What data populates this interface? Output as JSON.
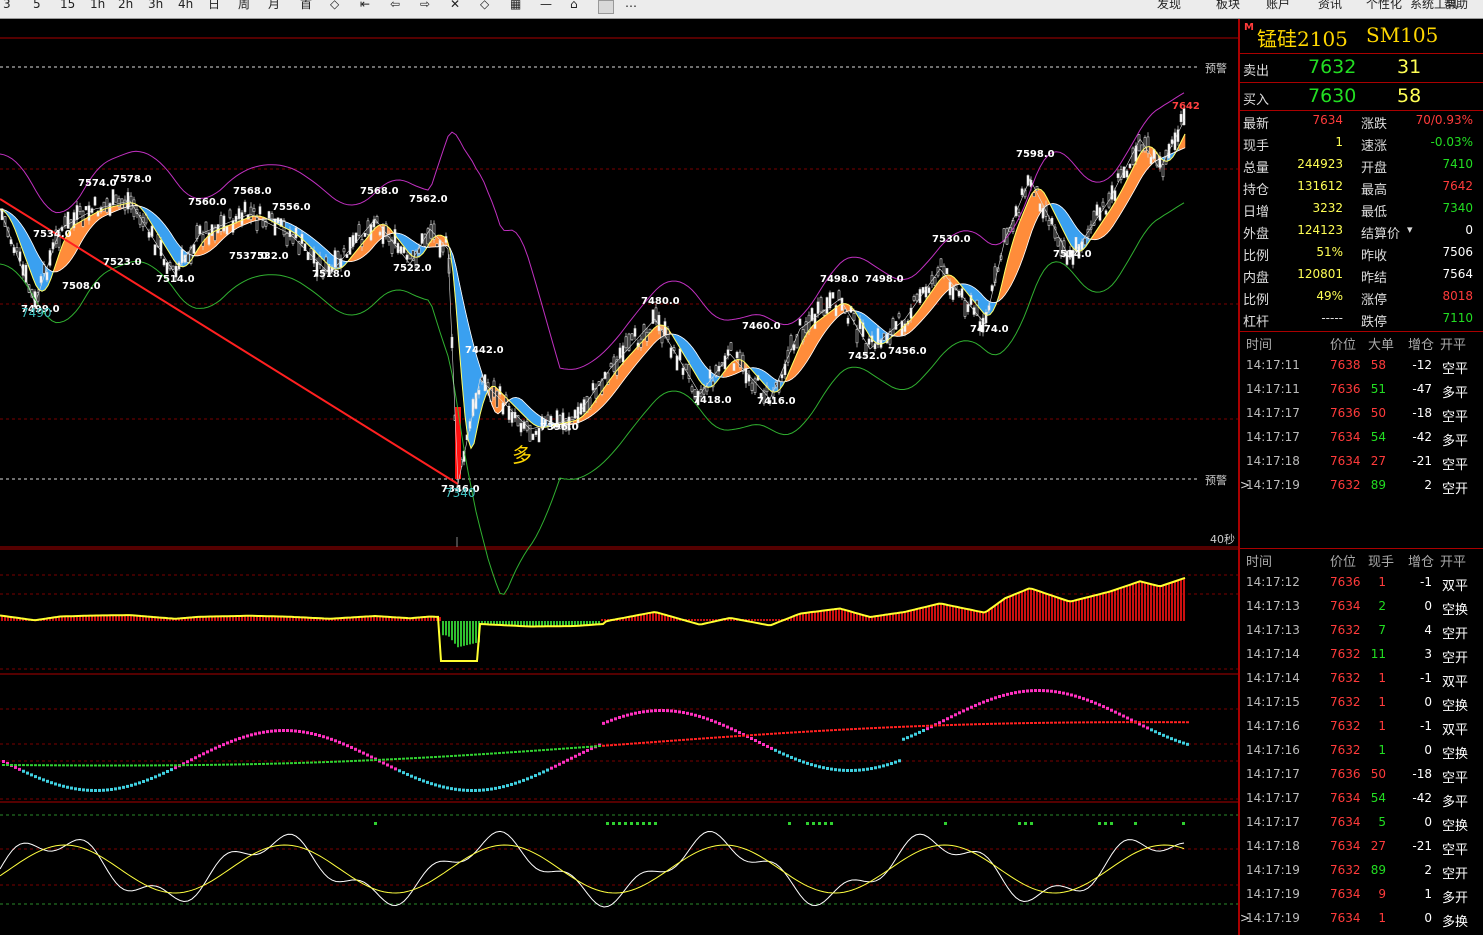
{
  "toolbar": {
    "left_items": [
      "3",
      "5",
      "15",
      "1h",
      "2h",
      "3h",
      "4h",
      "日",
      "周",
      "月",
      "首",
      "◇",
      "⇤",
      "⇦",
      "⇨",
      "✕",
      "◇",
      "▦",
      "—",
      "⌂"
    ],
    "menus": [
      "发现",
      "板块",
      "账户",
      "资讯",
      "个性化",
      "系统工具",
      "帮助"
    ]
  },
  "chart": {
    "price_labels": [
      "7574.0",
      "7578.0",
      "7560.0",
      "7568.0",
      "7556.0",
      "7568.0",
      "7562.0",
      "7534.0",
      "7523.0",
      "7537.0",
      "7532.0",
      "7514.0",
      "7508.0",
      "7499.0",
      "7490",
      "7518.0",
      "7522.0",
      "7442.0",
      "7396.0",
      "7346.0",
      "7340",
      "7480.0",
      "7460.0",
      "7498.0",
      "7498.0",
      "7418.0",
      "7416.0",
      "7452.0",
      "7456.0",
      "7530.0",
      "7474.0",
      "7598.0",
      "7534.0",
      "7642"
    ],
    "alert_label": "预警",
    "interval_label": "40秒",
    "signal_label": "多"
  },
  "quote": {
    "title": "锰硅2105",
    "code": "SM105",
    "marker": "M",
    "sell_label": "卖出",
    "sell_price": "7632",
    "sell_vol": "31",
    "buy_label": "买入",
    "buy_price": "7630",
    "buy_vol": "58",
    "rows": [
      {
        "l1": "最新",
        "v1": "7634",
        "c1": "#ff3b3b",
        "l2": "涨跌",
        "v2": "70/0.93%",
        "c2": "#ff3b3b"
      },
      {
        "l1": "现手",
        "v1": "1",
        "c1": "#ffff55",
        "l2": "速涨",
        "v2": "-0.03%",
        "c2": "#22dd22"
      },
      {
        "l1": "总量",
        "v1": "244923",
        "c1": "#ffff55",
        "l2": "开盘",
        "v2": "7410",
        "c2": "#22dd22"
      },
      {
        "l1": "持仓",
        "v1": "131612",
        "c1": "#ffff55",
        "l2": "最高",
        "v2": "7642",
        "c2": "#ff3b3b"
      },
      {
        "l1": "日增",
        "v1": "3232",
        "c1": "#ffff55",
        "l2": "最低",
        "v2": "7340",
        "c2": "#22dd22"
      },
      {
        "l1": "外盘",
        "v1": "124123",
        "c1": "#ffff55",
        "l2": "结算价",
        "v2": "0",
        "c2": "#ffffff"
      },
      {
        "l1": "比例",
        "v1": "51%",
        "c1": "#ffff55",
        "l2": "昨收",
        "v2": "7506",
        "c2": "#ffffff"
      },
      {
        "l1": "内盘",
        "v1": "120801",
        "c1": "#ffff55",
        "l2": "昨结",
        "v2": "7564",
        "c2": "#ffffff"
      },
      {
        "l1": "比例",
        "v1": "49%",
        "c1": "#ffff55",
        "l2": "涨停",
        "v2": "8018",
        "c2": "#ff3b3b"
      },
      {
        "l1": "杠杆",
        "v1": "-----",
        "c1": "#dddddd",
        "l2": "跌停",
        "v2": "7110",
        "c2": "#22dd22"
      }
    ],
    "trades1_header": {
      "time": "时间",
      "price": "价位",
      "big": "大单",
      "chg": "增仓",
      "kind": "开平"
    },
    "trades1": [
      {
        "time": "14:17:11",
        "price": "7638",
        "pc": "#ff3b3b",
        "vol": "58",
        "vc": "#ff3b3b",
        "chg": "-12",
        "kind": "空平",
        "sel": false
      },
      {
        "time": "14:17:11",
        "price": "7636",
        "pc": "#ff3b3b",
        "vol": "51",
        "vc": "#22dd22",
        "chg": "-47",
        "kind": "多平",
        "sel": false
      },
      {
        "time": "14:17:17",
        "price": "7636",
        "pc": "#ff3b3b",
        "vol": "50",
        "vc": "#ff3b3b",
        "chg": "-18",
        "kind": "空平",
        "sel": false
      },
      {
        "time": "14:17:17",
        "price": "7634",
        "pc": "#ff3b3b",
        "vol": "54",
        "vc": "#22dd22",
        "chg": "-42",
        "kind": "多平",
        "sel": false
      },
      {
        "time": "14:17:18",
        "price": "7634",
        "pc": "#ff3b3b",
        "vol": "27",
        "vc": "#ff3b3b",
        "chg": "-21",
        "kind": "空平",
        "sel": false
      },
      {
        "time": "14:17:19",
        "price": "7632",
        "pc": "#ff3b3b",
        "vol": "89",
        "vc": "#22dd22",
        "chg": "2",
        "kind": "空开",
        "sel": true
      }
    ],
    "trades2_header": {
      "time": "时间",
      "price": "价位",
      "big": "现手",
      "chg": "增仓",
      "kind": "开平"
    },
    "trades2": [
      {
        "time": "14:17:12",
        "price": "7636",
        "pc": "#ff3b3b",
        "vol": "1",
        "vc": "#ff3b3b",
        "chg": "-1",
        "kind": "双平",
        "sel": false
      },
      {
        "time": "14:17:13",
        "price": "7634",
        "pc": "#ff3b3b",
        "vol": "2",
        "vc": "#22dd22",
        "chg": "0",
        "kind": "空换",
        "sel": false
      },
      {
        "time": "14:17:13",
        "price": "7632",
        "pc": "#ff3b3b",
        "vol": "7",
        "vc": "#22dd22",
        "chg": "4",
        "kind": "空开",
        "sel": false
      },
      {
        "time": "14:17:14",
        "price": "7632",
        "pc": "#ff3b3b",
        "vol": "11",
        "vc": "#22dd22",
        "chg": "3",
        "kind": "空开",
        "sel": false
      },
      {
        "time": "14:17:14",
        "price": "7632",
        "pc": "#ff3b3b",
        "vol": "1",
        "vc": "#ff3b3b",
        "chg": "-1",
        "kind": "双平",
        "sel": false
      },
      {
        "time": "14:17:15",
        "price": "7632",
        "pc": "#ff3b3b",
        "vol": "1",
        "vc": "#ff3b3b",
        "chg": "0",
        "kind": "空换",
        "sel": false
      },
      {
        "time": "14:17:16",
        "price": "7632",
        "pc": "#ff3b3b",
        "vol": "1",
        "vc": "#ff3b3b",
        "chg": "-1",
        "kind": "双平",
        "sel": false
      },
      {
        "time": "14:17:16",
        "price": "7632",
        "pc": "#ff3b3b",
        "vol": "1",
        "vc": "#22dd22",
        "chg": "0",
        "kind": "空换",
        "sel": false
      },
      {
        "time": "14:17:17",
        "price": "7636",
        "pc": "#ff3b3b",
        "vol": "50",
        "vc": "#ff3b3b",
        "chg": "-18",
        "kind": "空平",
        "sel": false
      },
      {
        "time": "14:17:17",
        "price": "7634",
        "pc": "#ff3b3b",
        "vol": "54",
        "vc": "#22dd22",
        "chg": "-42",
        "kind": "多平",
        "sel": false
      },
      {
        "time": "14:17:17",
        "price": "7634",
        "pc": "#ff3b3b",
        "vol": "5",
        "vc": "#22dd22",
        "chg": "0",
        "kind": "空换",
        "sel": false
      },
      {
        "time": "14:17:18",
        "price": "7634",
        "pc": "#ff3b3b",
        "vol": "27",
        "vc": "#ff3b3b",
        "chg": "-21",
        "kind": "空平",
        "sel": false
      },
      {
        "time": "14:17:19",
        "price": "7632",
        "pc": "#ff3b3b",
        "vol": "89",
        "vc": "#22dd22",
        "chg": "2",
        "kind": "空开",
        "sel": false
      },
      {
        "time": "14:17:19",
        "price": "7634",
        "pc": "#ff3b3b",
        "vol": "9",
        "vc": "#ff3b3b",
        "chg": "1",
        "kind": "多开",
        "sel": false
      },
      {
        "time": "14:17:19",
        "price": "7634",
        "pc": "#ff3b3b",
        "vol": "1",
        "vc": "#ff3b3b",
        "chg": "0",
        "kind": "多换",
        "sel": true
      }
    ]
  }
}
